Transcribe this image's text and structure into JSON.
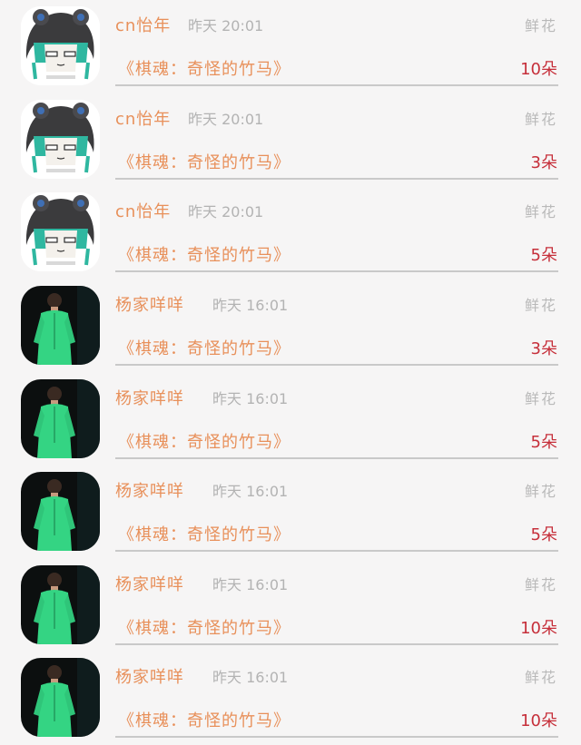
{
  "list": {
    "items": [
      {
        "name": "cn怡年",
        "time": "昨天 20:01",
        "kind": "鲜花",
        "book": "《棋魂：奇怪的竹马》",
        "count": "10朵",
        "avatar": "anime-avatar"
      },
      {
        "name": "cn怡年",
        "time": "昨天 20:01",
        "kind": "鲜花",
        "book": "《棋魂：奇怪的竹马》",
        "count": "3朵",
        "avatar": "anime-avatar"
      },
      {
        "name": "cn怡年",
        "time": "昨天 20:01",
        "kind": "鲜花",
        "book": "《棋魂：奇怪的竹马》",
        "count": "5朵",
        "avatar": "anime-avatar"
      },
      {
        "name": "杨家咩咩",
        "time": "昨天 16:01",
        "kind": "鲜花",
        "book": "《棋魂：奇怪的竹马》",
        "count": "3朵",
        "avatar": "photo-avatar"
      },
      {
        "name": "杨家咩咩",
        "time": "昨天 16:01",
        "kind": "鲜花",
        "book": "《棋魂：奇怪的竹马》",
        "count": "5朵",
        "avatar": "photo-avatar"
      },
      {
        "name": "杨家咩咩",
        "time": "昨天 16:01",
        "kind": "鲜花",
        "book": "《棋魂：奇怪的竹马》",
        "count": "5朵",
        "avatar": "photo-avatar"
      },
      {
        "name": "杨家咩咩",
        "time": "昨天 16:01",
        "kind": "鲜花",
        "book": "《棋魂：奇怪的竹马》",
        "count": "10朵",
        "avatar": "photo-avatar"
      },
      {
        "name": "杨家咩咩",
        "time": "昨天 16:01",
        "kind": "鲜花",
        "book": "《棋魂：奇怪的竹马》",
        "count": "10朵",
        "avatar": "photo-avatar"
      }
    ]
  },
  "colors": {
    "name": "#e8905a",
    "book": "#e8905a",
    "count": "#c62f3a",
    "meta": "#b3b3b3",
    "background": "#f6f5f5",
    "divider": "#c9c9c9"
  }
}
